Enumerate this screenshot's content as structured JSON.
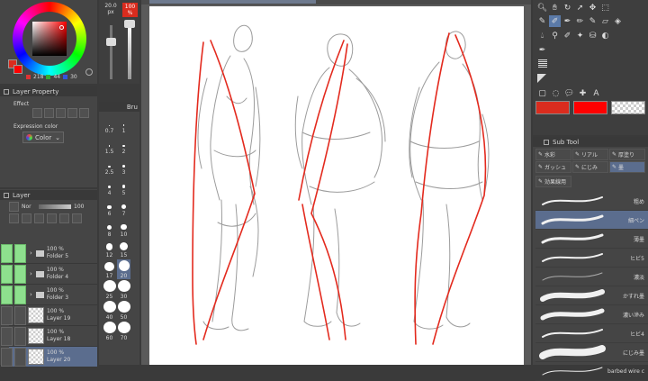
{
  "color": {
    "brush_size": "20.0",
    "brush_size_unit": "px",
    "opacity": "100",
    "opacity_unit": "%",
    "rgb": [
      "218",
      "44",
      "30"
    ],
    "main_color": "#da2c1e",
    "sub_colors": [
      "#da2c1e",
      "#ff0000"
    ]
  },
  "layer_property": {
    "title": "Layer Property",
    "effect_label": "Effect",
    "expression_color_label": "Expression color",
    "expression_color_value": "Color"
  },
  "layer_panel": {
    "title": "Layer",
    "blend_mode": "Nor",
    "opacity": "100",
    "layers": [
      {
        "opacity": "100 %",
        "name": "Folder 5",
        "type": "folder",
        "green": true
      },
      {
        "opacity": "100 %",
        "name": "Folder 4",
        "type": "folder",
        "green": true
      },
      {
        "opacity": "100 %",
        "name": "Folder 3",
        "type": "folder",
        "green": true
      },
      {
        "opacity": "100 %",
        "name": "Layer 19",
        "type": "raster",
        "green": false
      },
      {
        "opacity": "100 %",
        "name": "Layer 18",
        "type": "raster",
        "green": false
      },
      {
        "opacity": "100 %",
        "name": "Layer 20",
        "type": "raster",
        "green": false,
        "selected": true
      }
    ]
  },
  "brush_size_panel": {
    "title": "Bru",
    "sizes": [
      "0.7",
      "1",
      "1.5",
      "2",
      "2.5",
      "3",
      "4",
      "5",
      "6",
      "7",
      "8",
      "10",
      "12",
      "15",
      "17",
      "20",
      "25",
      "30",
      "40",
      "50",
      "60",
      "70"
    ]
  },
  "sub_tool": {
    "title": "Sub Tool",
    "groups": [
      "水彩",
      "リアル",
      "厚塗り",
      "ガッシュ",
      "にじみ",
      "墨"
    ],
    "group_row3": "効果線用",
    "brushes": [
      "粗め",
      "細ペン",
      "薄墨",
      "ヒビ5",
      "濃淡",
      "かすれ墨",
      "濃い滲み",
      "ヒビ4",
      "にじみ墨",
      "barbed wire c"
    ]
  }
}
